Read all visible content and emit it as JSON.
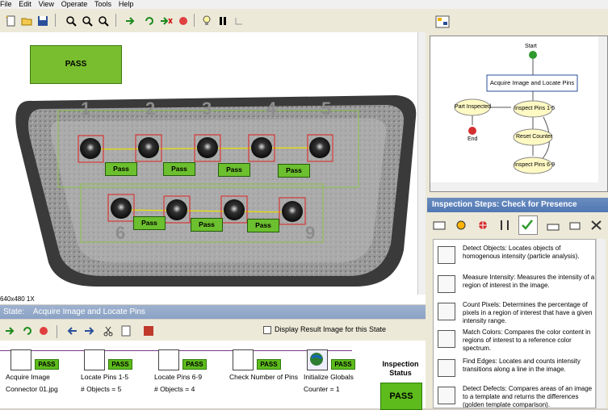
{
  "menu": [
    "File",
    "Edit",
    "View",
    "Operate",
    "Tools",
    "Help"
  ],
  "image": {
    "result_label": "PASS",
    "pin_numbers_top": [
      "1",
      "2",
      "3",
      "4",
      "5"
    ],
    "pin_numbers_bottom": [
      "6",
      "9"
    ],
    "pin_results_top": [
      "Pass",
      "Pass",
      "Pass",
      "Pass"
    ],
    "pin_results_bottom": [
      "Pass",
      "Pass",
      "Pass"
    ],
    "resolution": "640x480 1X"
  },
  "state": {
    "label": "State:",
    "name": "Acquire Image and Locate Pins",
    "display_result_label": "Display Result Image for this State"
  },
  "steps": [
    {
      "name": "Acquire Image",
      "detail": "Connector 01.jpg",
      "result": "PASS",
      "icon": "camera-icon"
    },
    {
      "name": "Locate Pins 1-5",
      "detail": "# Objects = 5",
      "result": "PASS",
      "icon": "detect-objects-icon"
    },
    {
      "name": "Locate Pins 6-9",
      "detail": "# Objects = 4",
      "result": "PASS",
      "icon": "detect-objects-icon"
    },
    {
      "name": "Check Number of Pins",
      "detail": "",
      "result": "PASS",
      "icon": "calculator-icon"
    },
    {
      "name": "Initialize Globals",
      "detail": "Counter = 1",
      "result": "PASS",
      "icon": "globe-icon"
    }
  ],
  "inspection_status": {
    "label": "Inspection Status",
    "value": "PASS"
  },
  "flow": {
    "start": "Start",
    "acquire": "Acquire Image and Locate Pins",
    "part_inspected": "Part Inspected",
    "inspect_1_5": "Inspect Pins 1-5",
    "reset": "Reset Counter",
    "inspect_6_9": "Inspect Pins 6-9",
    "end": "End"
  },
  "inspection_steps": {
    "title": "Inspection Steps: Check for Presence",
    "items": [
      {
        "title": "Detect Objects:",
        "desc": "Locates objects of homogenous intensity (particle analysis)."
      },
      {
        "title": "Measure Intensity:",
        "desc": "Measures the intensity of a region of interest in the image."
      },
      {
        "title": "Count Pixels:",
        "desc": "Determines the percentage of pixels in a region of interest that have a given intensity range."
      },
      {
        "title": "Match Colors:",
        "desc": "Compares the color content in regions of interest to a reference color spectrum."
      },
      {
        "title": "Find Edges:",
        "desc": "Locates and counts intensity transitions along a line in the image."
      },
      {
        "title": "Detect Defects:",
        "desc": "Compares areas of an image to a template and returns the differences (golden template comparison)."
      }
    ]
  },
  "colors": {
    "pass_green": "#5dbb1c",
    "state_bar": "#8aa2c4",
    "header_blue": "#5178b3"
  }
}
